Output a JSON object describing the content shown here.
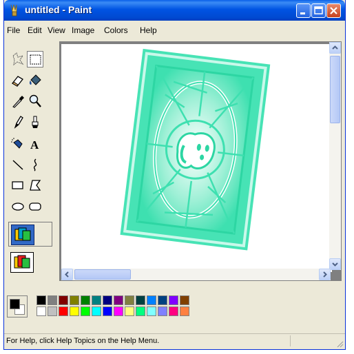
{
  "window": {
    "title": "untitled - Paint",
    "title_icon": "paint-app-icon",
    "controls": [
      "minimize-icon",
      "maximize-icon",
      "close-icon"
    ]
  },
  "menu": {
    "file": "File",
    "edit": "Edit",
    "view": "View",
    "image": "Image",
    "colors": "Colors",
    "help": "Help"
  },
  "tools": [
    "free-form-select-icon",
    "select-icon",
    "eraser-icon",
    "fill-icon",
    "pick-color-icon",
    "magnifier-icon",
    "pencil-icon",
    "brush-icon",
    "airbrush-icon",
    "text-icon",
    "line-icon",
    "curve-icon",
    "rectangle-icon",
    "polygon-icon",
    "ellipse-icon",
    "rounded-rectangle-icon"
  ],
  "selected_tool": "select",
  "text_tool_label": "A",
  "palette": {
    "foreground": "#000000",
    "background": "#ffffff",
    "row1": [
      "#000000",
      "#808080",
      "#800000",
      "#808000",
      "#008000",
      "#008080",
      "#000080",
      "#800080",
      "#808040",
      "#004040",
      "#0080ff",
      "#004080",
      "#8000ff",
      "#804000"
    ],
    "row2": [
      "#ffffff",
      "#c0c0c0",
      "#ff0000",
      "#ffff00",
      "#00ff00",
      "#00ffff",
      "#0000ff",
      "#ff00ff",
      "#ffff80",
      "#00ff80",
      "#80ffff",
      "#8080ff",
      "#ff0080",
      "#ff8040"
    ]
  },
  "status": {
    "help_text": "For Help, click Help Topics on the Help Menu."
  },
  "image_colors": {
    "teal_light": "#b9f5e1",
    "teal_mid": "#63e7c0",
    "teal_dark": "#2fd9a6"
  }
}
